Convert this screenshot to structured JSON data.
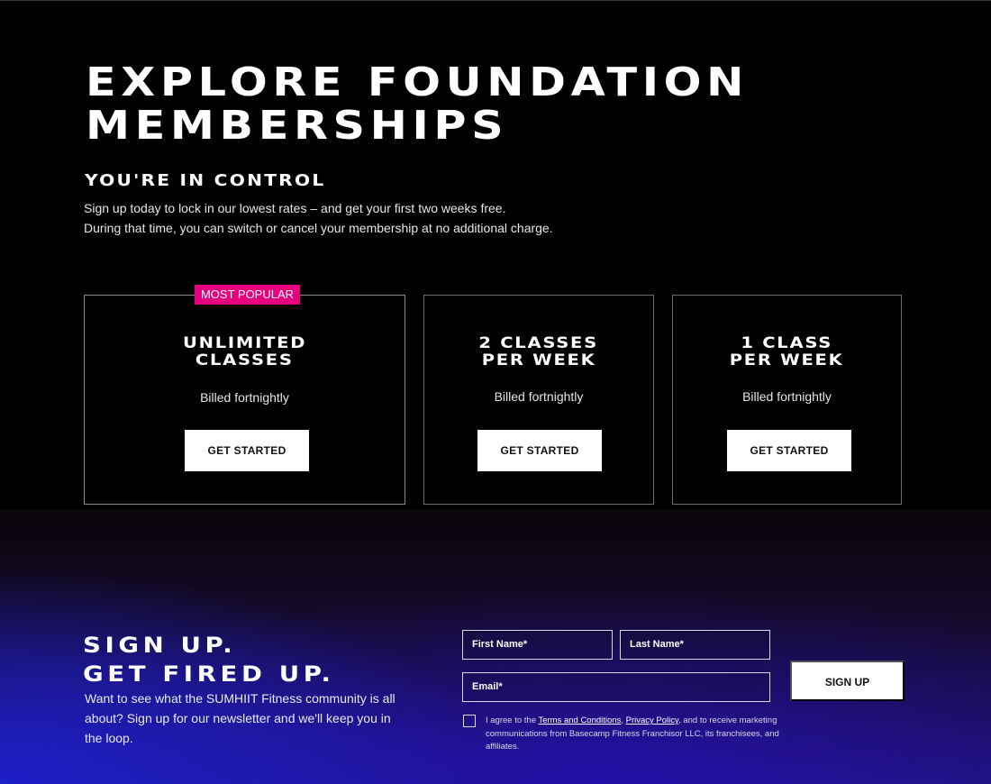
{
  "hero": {
    "title_line1": "EXPLORE FOUNDATION",
    "title_line2": "MEMBERSHIPS",
    "subheading": "YOU'RE IN CONTROL",
    "intro_line1": "Sign up today to lock in our lowest rates – and get your first two weeks free.",
    "intro_line2": "During that time, you can switch or cancel your membership at no additional charge."
  },
  "plans": [
    {
      "badge": "MOST POPULAR",
      "name_line1": "UNLIMITED",
      "name_line2": "CLASSES",
      "billing": "Billed fortnightly",
      "cta": "GET STARTED"
    },
    {
      "name_line1": "2 CLASSES",
      "name_line2": "PER WEEK",
      "billing": "Billed fortnightly",
      "cta": "GET STARTED"
    },
    {
      "name_line1": "1 CLASS",
      "name_line2": "PER WEEK",
      "billing": "Billed fortnightly",
      "cta": "GET STARTED"
    }
  ],
  "signup": {
    "title_line1": "SIGN UP.",
    "title_line2": "GET FIRED UP.",
    "text": "Want to see what the SUMHIIT Fitness community is all about? Sign up for our newsletter and we'll keep you in the loop.",
    "first_name_label": "First Name*",
    "last_name_label": "Last Name*",
    "email_label": "Email*",
    "button": "SIGN UP",
    "consent_prefix": "I agree to the ",
    "terms_link": "Terms and Conditions",
    "consent_sep": ", ",
    "privacy_link": "Privacy Policy",
    "consent_suffix": ", and to receive marketing communications from Basecamp Fitness Franchisor LLC, its franchisees, and affiliates."
  },
  "colors": {
    "badge": "#e6007e",
    "background": "#000000",
    "gradient_blue": "#1d1fc8"
  }
}
